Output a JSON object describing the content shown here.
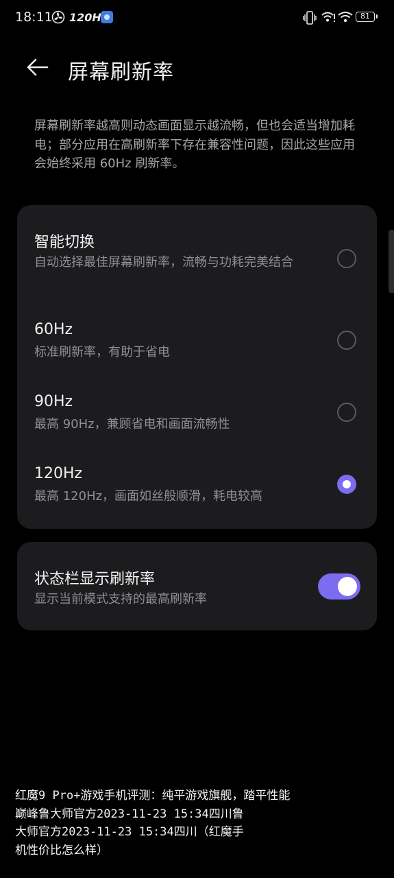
{
  "status_bar": {
    "time": "18:11",
    "refresh_badge": "120Hz",
    "battery": "81",
    "icons": [
      "fan-icon",
      "app-notification-icon",
      "vibrate-icon",
      "wifi-calling-icon",
      "wifi-icon",
      "battery-icon"
    ]
  },
  "header": {
    "back_icon": "back-arrow-icon",
    "title": "屏幕刷新率"
  },
  "description": "屏幕刷新率越高则动态画面显示越流畅，但也会适当增加耗电；部分应用在高刷新率下存在兼容性问题，因此这些应用会始终采用 60Hz 刷新率。",
  "options": [
    {
      "title": "智能切换",
      "subtitle": "自动选择最佳屏幕刷新率，流畅与功耗完美结合",
      "selected": false
    },
    {
      "title": "60Hz",
      "subtitle": "标准刷新率，有助于省电",
      "selected": false
    },
    {
      "title": "90Hz",
      "subtitle": "最高 90Hz，兼顾省电和画面流畅性",
      "selected": false
    },
    {
      "title": "120Hz",
      "subtitle": "最高 120Hz，画面如丝般顺滑，耗电较高",
      "selected": true
    }
  ],
  "status_bar_setting": {
    "title": "状态栏显示刷新率",
    "subtitle": "显示当前模式支持的最高刷新率",
    "enabled": true
  },
  "accent_color": "#7b6cf0",
  "watermark_lines": [
    "红魔9 Pro+游戏手机评测：纯平游戏旗舰，踏平性能",
    "巅峰鲁大师官方2023-11-23 15:34四川鲁",
    "大师官方2023-11-23 15:34四川（红魔手",
    "机性价比怎么样）"
  ]
}
